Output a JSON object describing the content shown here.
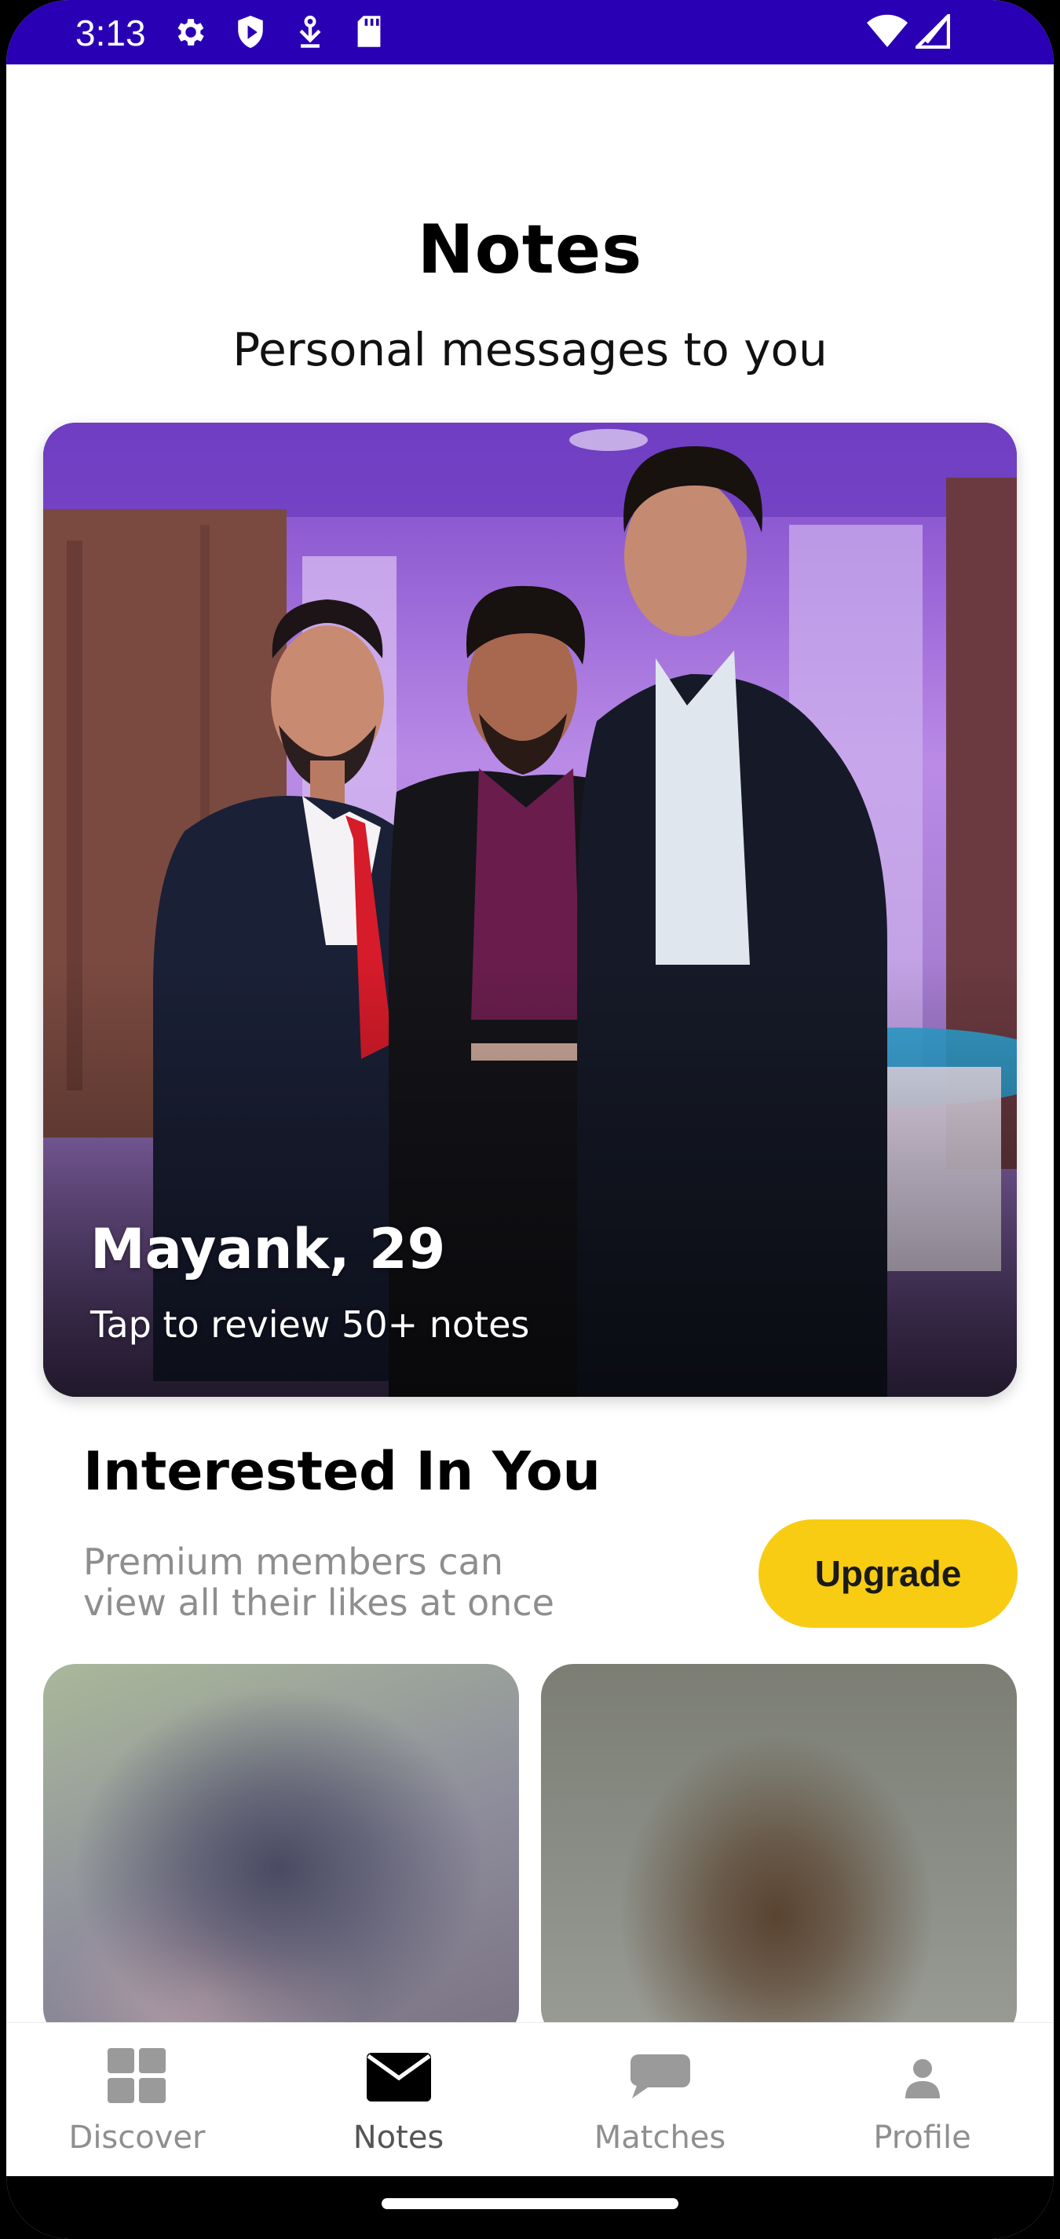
{
  "status_bar": {
    "time": "3:13",
    "left_icons": [
      "gear-icon",
      "shield-play-icon",
      "download-icon",
      "sd-card-icon"
    ],
    "right_icons": [
      "wifi-icon",
      "no-signal-icon"
    ],
    "color": "#2a00b4"
  },
  "header": {
    "title": "Notes",
    "subtitle": "Personal messages to you"
  },
  "featured_note": {
    "name_age": "Mayank, 29",
    "caption": "Tap to review 50+ notes"
  },
  "interested": {
    "title": "Interested In You",
    "description": "Premium members can view all their likes at once",
    "upgrade_label": "Upgrade",
    "accent_color": "#f7cc12"
  },
  "bottom_nav": {
    "items": [
      {
        "label": "Discover",
        "icon": "grid-icon",
        "active": false
      },
      {
        "label": "Notes",
        "icon": "envelope-icon",
        "active": true
      },
      {
        "label": "Matches",
        "icon": "chat-bubble-icon",
        "active": false
      },
      {
        "label": "Profile",
        "icon": "person-icon",
        "active": false
      }
    ]
  }
}
